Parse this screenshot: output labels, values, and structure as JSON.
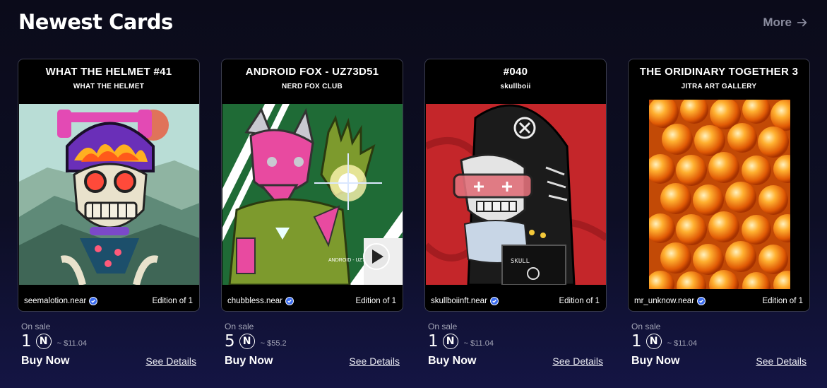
{
  "section": {
    "title": "Newest Cards",
    "more_label": "More"
  },
  "cards": [
    {
      "title": "WHAT THE HELMET #41",
      "collection": "WHAT THE HELMET",
      "owner": "seemalotion.near",
      "edition": "Edition of 1",
      "on_sale_label": "On sale",
      "price": "1",
      "currency_symbol": "Ⓝ",
      "usd": "~ $11.04",
      "buy_label": "Buy Now",
      "details_label": "See Details"
    },
    {
      "title": "ANDROID FOX - UZ73D51",
      "collection": "NERD FOX CLUB",
      "owner": "chubbless.near",
      "edition": "Edition of 1",
      "on_sale_label": "On sale",
      "price": "5",
      "currency_symbol": "Ⓝ",
      "usd": "~ $55.2",
      "buy_label": "Buy Now",
      "details_label": "See Details",
      "watermark": "ANDROID - UZ73"
    },
    {
      "title": "#040",
      "collection": "skullboii",
      "owner": "skullboiinft.near",
      "edition": "Edition of 1",
      "on_sale_label": "On sale",
      "price": "1",
      "currency_symbol": "Ⓝ",
      "usd": "~ $11.04",
      "buy_label": "Buy Now",
      "details_label": "See Details"
    },
    {
      "title": "THE ORIDINARY TOGETHER 3",
      "collection": "JITRA ART GALLERY",
      "owner": "mr_unknow.near",
      "edition": "Edition of 1",
      "on_sale_label": "On sale",
      "price": "1",
      "currency_symbol": "Ⓝ",
      "usd": "~ $11.04",
      "buy_label": "Buy Now",
      "details_label": "See Details"
    }
  ],
  "colors": {
    "accent_blue": "#3b6cf0",
    "muted_text": "#a4a6b7",
    "card_border": "#3b3d4e"
  },
  "icons": {
    "more": "arrow-right-icon",
    "verified": "verified-badge-icon",
    "currency": "near-token-icon",
    "play": "play-icon"
  }
}
